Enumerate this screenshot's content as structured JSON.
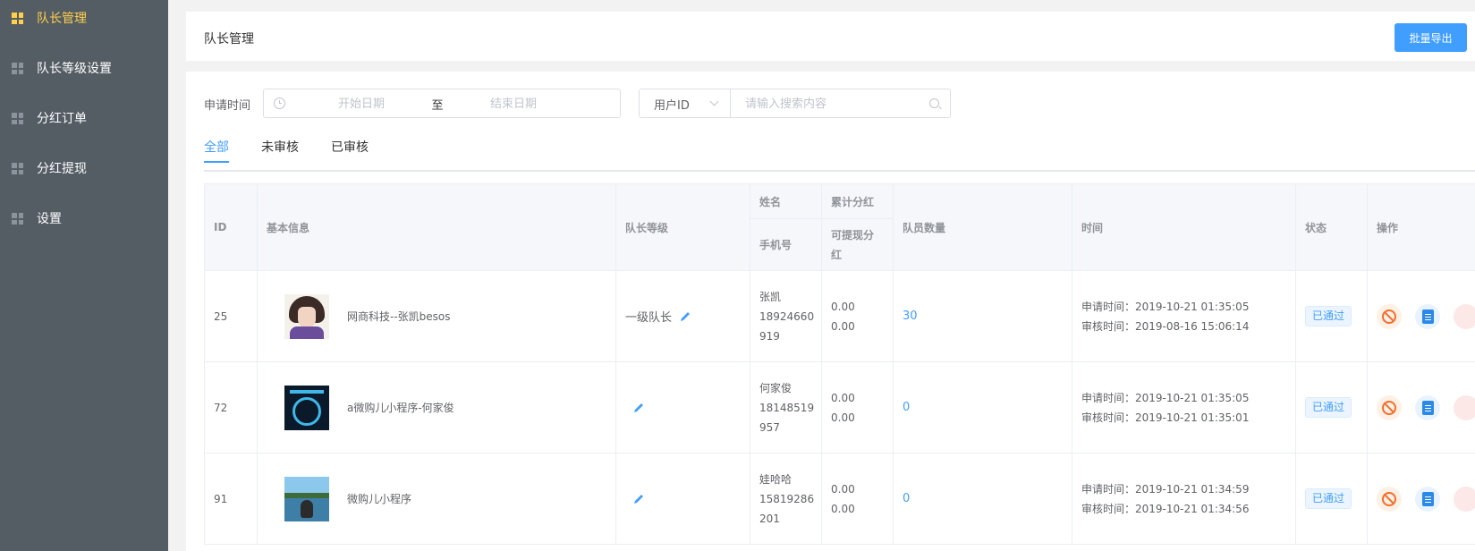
{
  "sidebar": {
    "items": [
      {
        "label": "队长管理",
        "icon": "grid-icon",
        "active": true
      },
      {
        "label": "队长等级设置",
        "icon": "grid-icon",
        "active": false
      },
      {
        "label": "分红订单",
        "icon": "grid-icon",
        "active": false
      },
      {
        "label": "分红提现",
        "icon": "grid-icon",
        "active": false
      },
      {
        "label": "设置",
        "icon": "grid-icon",
        "active": false
      }
    ]
  },
  "header": {
    "title": "队长管理",
    "export_label": "批量导出"
  },
  "filters": {
    "date_label": "申请时间",
    "start_placeholder": "开始日期",
    "separator": "至",
    "end_placeholder": "结束日期",
    "search_field_selected": "用户ID",
    "search_placeholder": "请输入搜索内容"
  },
  "tabs": [
    {
      "label": "全部",
      "active": true
    },
    {
      "label": "未审核",
      "active": false
    },
    {
      "label": "已审核",
      "active": false
    }
  ],
  "table": {
    "headers": {
      "id": "ID",
      "info": "基本信息",
      "level": "队长等级",
      "name": "姓名",
      "phone": "手机号",
      "total_bonus": "累计分红",
      "withdrawable_line1": "可提现分",
      "withdrawable_line2": "红",
      "member_count": "队员数量",
      "time": "时间",
      "status": "状态",
      "ops": "操作"
    },
    "rows": [
      {
        "id": "25",
        "avatar": "avatar-illustration",
        "info": "网商科技--张凯besos",
        "level": "一级队长",
        "name": "张凯",
        "phone_line1": "18924660",
        "phone_line2": "919",
        "total_bonus": "0.00",
        "withdrawable": "0.00",
        "member_count": "30",
        "apply_time": "申请时间：2019-10-21 01:35:05",
        "review_time": "审核时间：2019-08-16 15:06:14",
        "status": "已通过"
      },
      {
        "id": "72",
        "avatar": "avatar-app-graphic",
        "info": "a微购儿小程序-何家俊",
        "level": "",
        "name": "何家俊",
        "phone_line1": "18148519",
        "phone_line2": "957",
        "total_bonus": "0.00",
        "withdrawable": "0.00",
        "member_count": "0",
        "apply_time": "申请时间：2019-10-21 01:35:05",
        "review_time": "审核时间：2019-10-21 01:35:01",
        "status": "已通过"
      },
      {
        "id": "91",
        "avatar": "avatar-landscape-photo",
        "info": "微购儿小程序",
        "level": "",
        "name": "娃哈哈",
        "phone_line1": "15819286",
        "phone_line2": "201",
        "total_bonus": "0.00",
        "withdrawable": "0.00",
        "member_count": "0",
        "apply_time": "申请时间：2019-10-21 01:34:59",
        "review_time": "审核时间：2019-10-21 01:34:56",
        "status": "已通过"
      }
    ]
  },
  "colors": {
    "sidebar_bg": "#545c64",
    "active_menu": "#ffd04b",
    "primary": "#409eff",
    "ban": "#f56c2b"
  }
}
